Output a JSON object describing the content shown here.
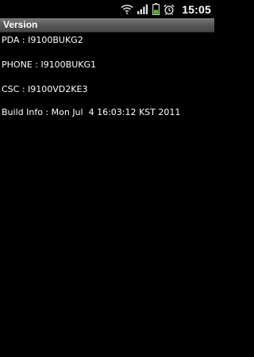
{
  "status_bar": {
    "time": "15:05",
    "icons": [
      "wifi-icon",
      "signal-icon",
      "battery-icon",
      "alarm-icon"
    ],
    "battery_color": "#49c41d"
  },
  "app": {
    "title": "Version"
  },
  "info": {
    "pda": "PDA : I9100BUKG2",
    "phone": "PHONE : I9100BUKG1",
    "csc": "CSC : I9100VD2KE3",
    "build": "Build Info : Mon Jul  4 16:03:12 KST 2011"
  }
}
